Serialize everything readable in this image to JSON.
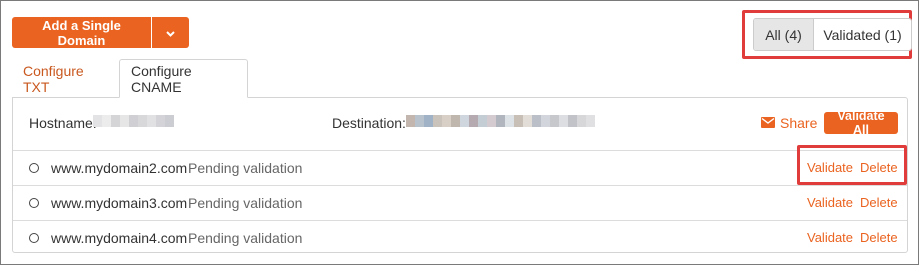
{
  "toolbar": {
    "add_domain_label": "Add a Single Domain",
    "dropdown_icon": "chevron-down-icon"
  },
  "filters": {
    "all_label": "All (4)",
    "validated_label": "Validated (1)",
    "active": "All (4)"
  },
  "tabs": [
    {
      "label": "Configure TXT",
      "active": false
    },
    {
      "label": "Configure CNAME",
      "active": true
    }
  ],
  "panel": {
    "hostname_label": "Hostname:",
    "destination_label": "Destination:",
    "share_label": "Share",
    "share_icon": "envelope-icon",
    "validate_all_label": "Validate All"
  },
  "domains": [
    {
      "name": "www.mydomain2.com",
      "status": "Pending validation",
      "validate_label": "Validate",
      "delete_label": "Delete"
    },
    {
      "name": "www.mydomain3.com",
      "status": "Pending validation",
      "validate_label": "Validate",
      "delete_label": "Delete"
    },
    {
      "name": "www.mydomain4.com",
      "status": "Pending validation",
      "validate_label": "Validate",
      "delete_label": "Delete"
    }
  ],
  "colors": {
    "accent": "#ea6320",
    "highlight": "#e03c3c",
    "tab_link": "#c9581f"
  }
}
